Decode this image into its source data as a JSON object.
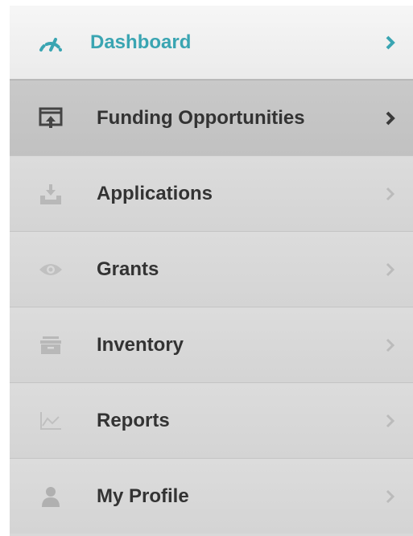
{
  "colors": {
    "accent": "#3aa5b2",
    "text": "#333333",
    "icon_muted": "#b8b8b8",
    "icon_dark": "#444444"
  },
  "menu": {
    "items": [
      {
        "label": "Dashboard",
        "icon": "speedometer-icon",
        "state": "active"
      },
      {
        "label": "Funding Opportunities",
        "icon": "upload-window-icon",
        "state": "hovered"
      },
      {
        "label": "Applications",
        "icon": "download-tray-icon",
        "state": "normal"
      },
      {
        "label": "Grants",
        "icon": "eye-icon",
        "state": "normal"
      },
      {
        "label": "Inventory",
        "icon": "archive-box-icon",
        "state": "normal"
      },
      {
        "label": "Reports",
        "icon": "line-chart-icon",
        "state": "normal"
      },
      {
        "label": "My Profile",
        "icon": "user-icon",
        "state": "normal"
      }
    ]
  }
}
